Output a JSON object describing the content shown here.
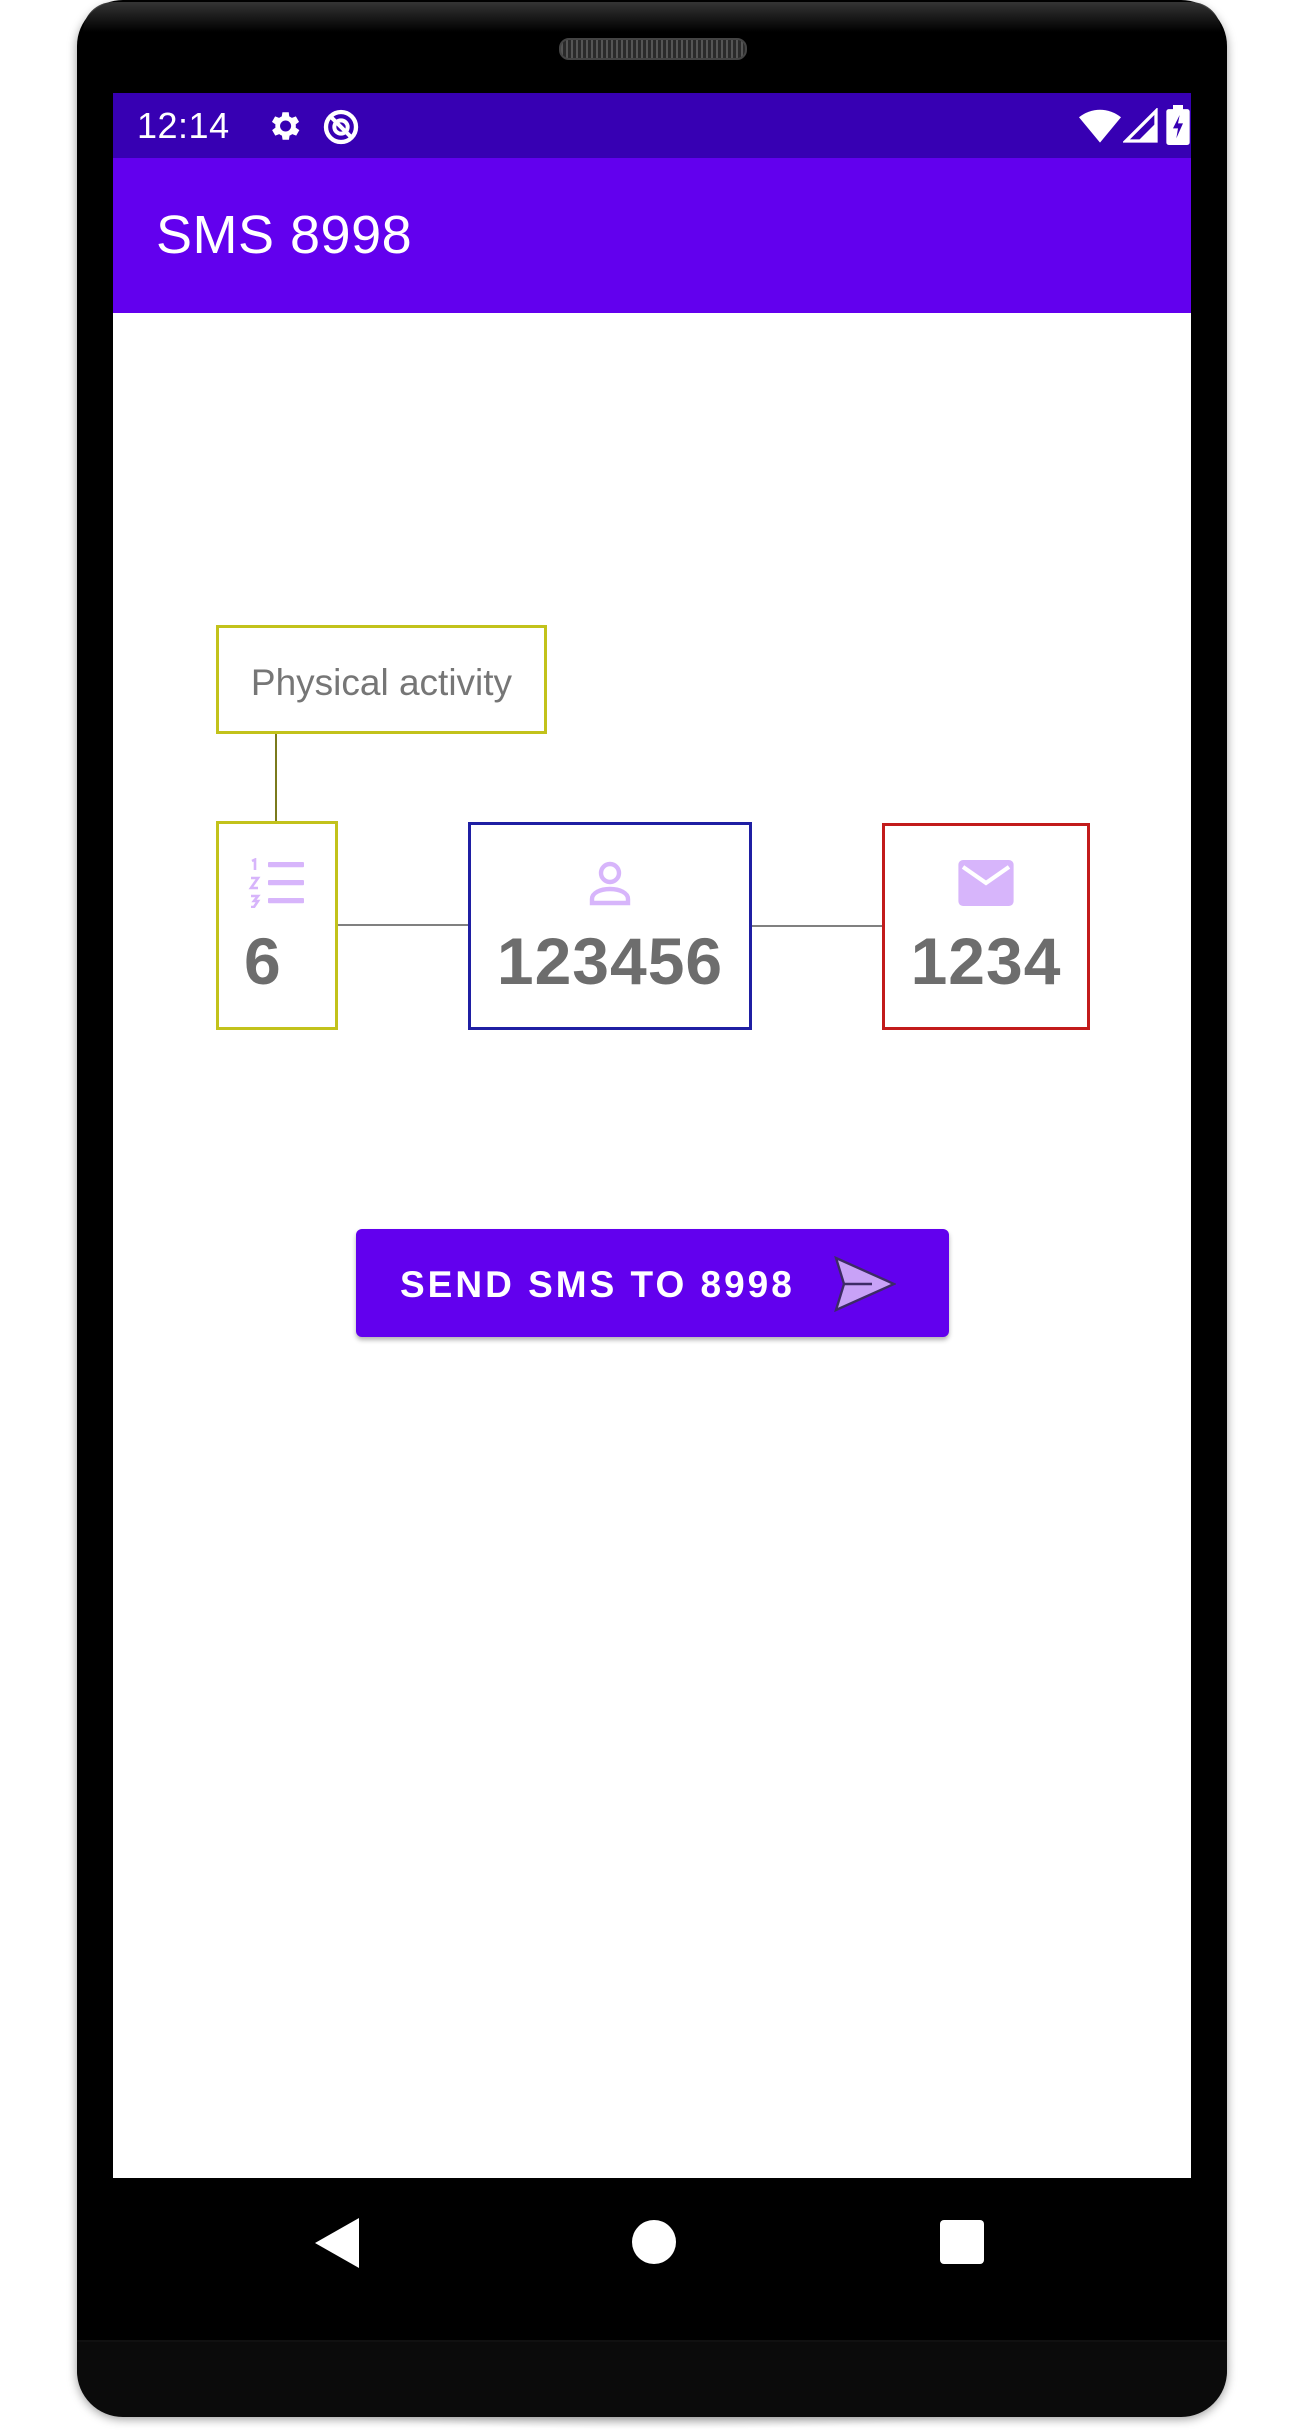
{
  "status_bar": {
    "time": "12:14",
    "icons": [
      "gear-icon",
      "sync-icon",
      "wifi-icon",
      "signal-icon",
      "battery-charging-icon"
    ]
  },
  "app_bar": {
    "title": "SMS 8998"
  },
  "form": {
    "category_label": "Physical activity",
    "number_value": "6",
    "number_icon": "numbered-list-icon",
    "person_value": "123456",
    "person_icon": "person-icon",
    "code_value": "1234",
    "code_icon": "envelope-icon"
  },
  "send_button": {
    "label": "SEND SMS TO 8998",
    "icon": "send-icon"
  },
  "navigation": {
    "buttons": [
      "back-icon",
      "home-icon",
      "recents-icon"
    ]
  },
  "colors": {
    "status_bar": "#3700b3",
    "app_bar": "#6200ee",
    "accent_icon": "#d7b5fb",
    "category_border": "#c2c21b",
    "person_border": "#1f1fa3",
    "code_border": "#c21b1b"
  }
}
